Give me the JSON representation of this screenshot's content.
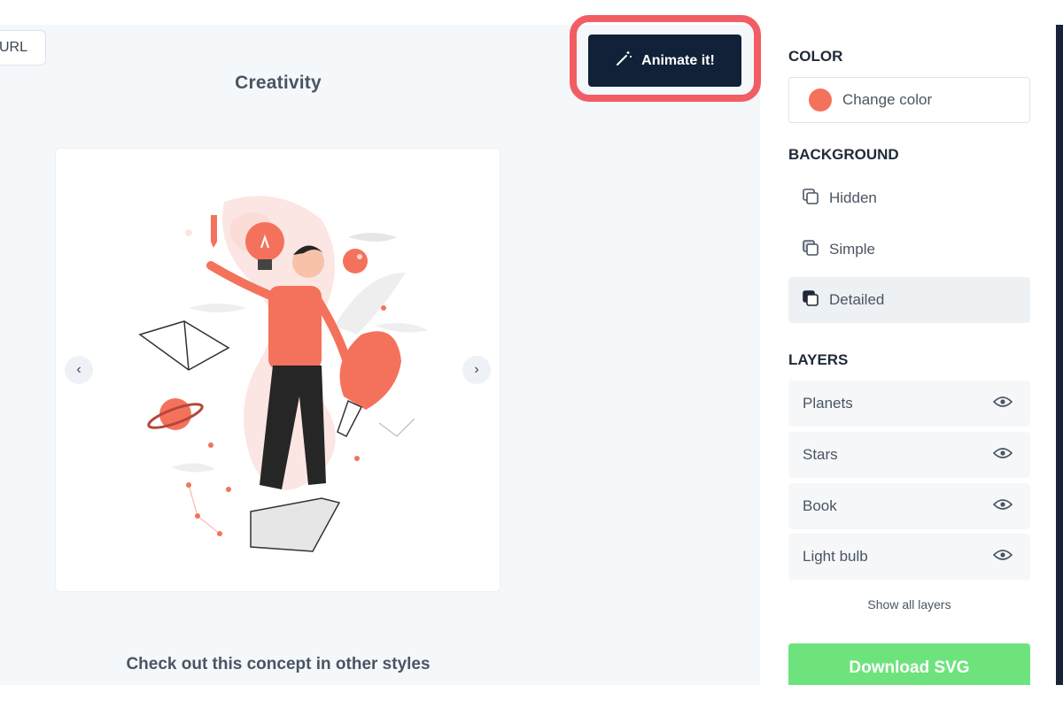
{
  "toolbar": {
    "url_label": "URL",
    "animate_label": "Animate it!"
  },
  "page": {
    "title": "Creativity",
    "other_styles_text": "Check out this concept in other styles"
  },
  "panel": {
    "color_title": "COLOR",
    "change_color_label": "Change color",
    "accent_color": "#f4725c",
    "background_title": "BACKGROUND",
    "background_options": [
      {
        "label": "Hidden",
        "selected": false
      },
      {
        "label": "Simple",
        "selected": false
      },
      {
        "label": "Detailed",
        "selected": true
      }
    ],
    "layers_title": "LAYERS",
    "layers": [
      {
        "label": "Planets",
        "icon": "eye-icon"
      },
      {
        "label": "Stars",
        "icon": "eye-icon"
      },
      {
        "label": "Book",
        "icon": "eye-icon"
      },
      {
        "label": "Light bulb",
        "icon": "eye-icon"
      }
    ],
    "show_all_label": "Show all layers",
    "download_label": "Download SVG"
  },
  "colors": {
    "dark_navy": "#102138",
    "highlight_red": "#f25d64",
    "download_green": "#6ee37d"
  }
}
